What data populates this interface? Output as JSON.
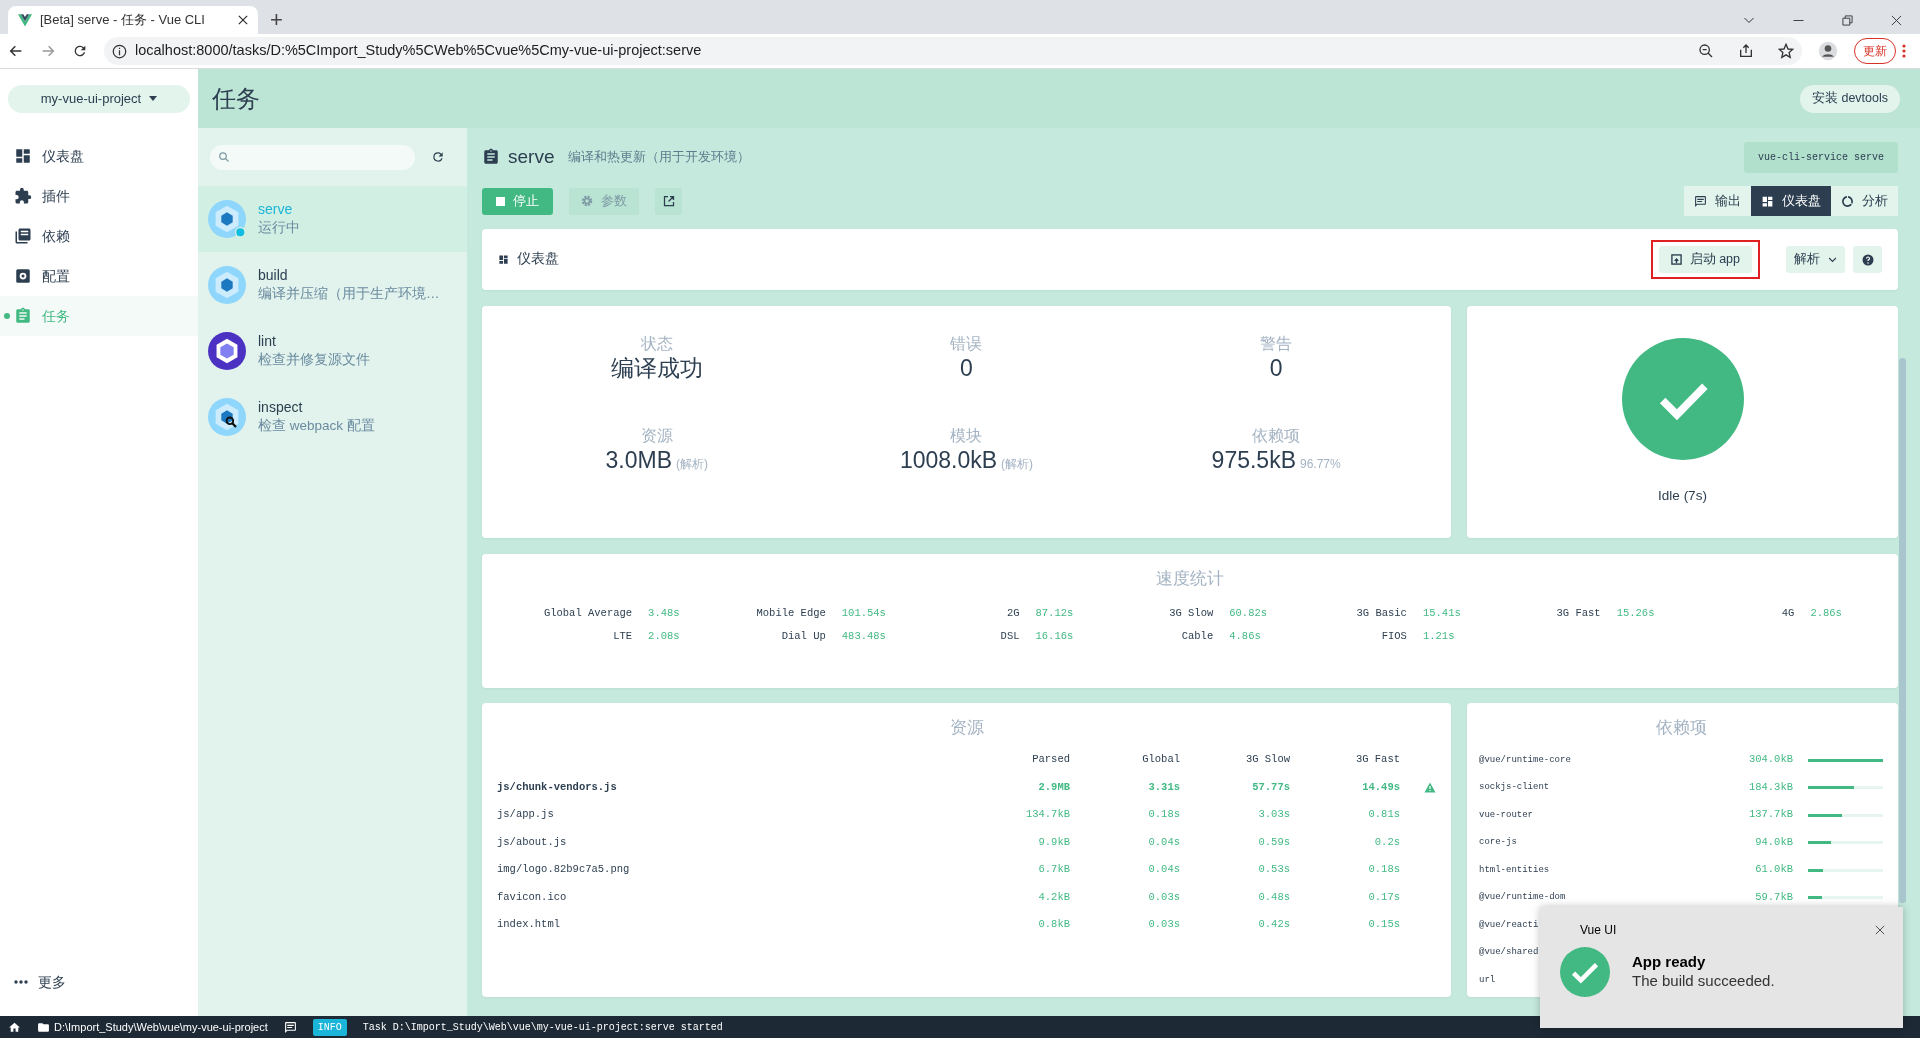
{
  "browser": {
    "tab_title": "[Beta] serve - 任务 - Vue CLI",
    "new_tab": "+",
    "url": "localhost:8000/tasks/D:%5CImport_Study%5CWeb%5Cvue%5Cmy-vue-ui-project:serve",
    "update_button": "更新"
  },
  "project_selector": "my-vue-ui-project",
  "page_title": "任务",
  "devtools_button": "安装 devtools",
  "sidebar": {
    "items": [
      {
        "label": "仪表盘",
        "kind": "dashboard",
        "selected": false
      },
      {
        "label": "插件",
        "kind": "plugins",
        "selected": false
      },
      {
        "label": "依赖",
        "kind": "dependencies",
        "selected": false
      },
      {
        "label": "配置",
        "kind": "configuration",
        "selected": false
      },
      {
        "label": "任务",
        "kind": "tasks",
        "selected": true
      }
    ],
    "more": "更多"
  },
  "tasks": [
    {
      "name": "serve",
      "description": "运行中",
      "kind": "webpack",
      "running": true,
      "selected": true
    },
    {
      "name": "build",
      "description": "编译并压缩（用于生产环境…",
      "kind": "webpack",
      "running": false,
      "selected": false
    },
    {
      "name": "lint",
      "description": "检查并修复源文件",
      "kind": "eslint",
      "running": false,
      "selected": false
    },
    {
      "name": "inspect",
      "description": "检查 webpack 配置",
      "kind": "inspect",
      "running": false,
      "selected": false
    }
  ],
  "task": {
    "name": "serve",
    "description": "编译和热更新（用于开发环境）",
    "command": "vue-cli-service serve",
    "stop_button": "停止",
    "params_button": "参数",
    "params_disabled": true,
    "views": [
      {
        "label": "输出",
        "kind": "output",
        "selected": false
      },
      {
        "label": "仪表盘",
        "kind": "dashboard",
        "selected": true
      },
      {
        "label": "分析",
        "kind": "analysis",
        "selected": false
      }
    ]
  },
  "dashboard": {
    "title": "仪表盘",
    "launch_button": "启动 app",
    "launch_highlighted": true,
    "analyzer_dropdown": "解析"
  },
  "stats": [
    {
      "label": "状态",
      "value": "编译成功"
    },
    {
      "label": "错误",
      "value": "0"
    },
    {
      "label": "警告",
      "value": "0"
    },
    {
      "label": "资源",
      "value": "3.0MB",
      "note": "(解析)"
    },
    {
      "label": "模块",
      "value": "1008.0kB",
      "note": "(解析)"
    },
    {
      "label": "依赖项",
      "value": "975.5kB",
      "note": "96.77%"
    }
  ],
  "status_card": {
    "caption": "Idle (7s)",
    "ok": true
  },
  "speed": {
    "title": "速度统计",
    "rows": [
      [
        {
          "label": "Global Average",
          "value": "3.48s"
        },
        {
          "label": "Mobile Edge",
          "value": "101.54s"
        },
        {
          "label": "2G",
          "value": "87.12s"
        },
        {
          "label": "3G Slow",
          "value": "60.82s"
        },
        {
          "label": "3G Basic",
          "value": "15.41s"
        },
        {
          "label": "3G Fast",
          "value": "15.26s"
        },
        {
          "label": "4G",
          "value": "2.86s"
        }
      ],
      [
        {
          "label": "LTE",
          "value": "2.08s"
        },
        {
          "label": "Dial Up",
          "value": "483.48s"
        },
        {
          "label": "DSL",
          "value": "16.16s"
        },
        {
          "label": "Cable",
          "value": "4.86s"
        },
        {
          "label": "FIOS",
          "value": "1.21s"
        }
      ]
    ]
  },
  "assets": {
    "title": "资源",
    "columns": [
      "Parsed",
      "Global",
      "3G Slow",
      "3G Fast"
    ],
    "rows": [
      {
        "name": "js/chunk-vendors.js",
        "values": [
          "2.9MB",
          "3.31s",
          "57.77s",
          "14.49s"
        ],
        "big": true
      },
      {
        "name": "js/app.js",
        "values": [
          "134.7kB",
          "0.18s",
          "3.03s",
          "0.81s"
        ],
        "big": false
      },
      {
        "name": "js/about.js",
        "values": [
          "9.9kB",
          "0.04s",
          "0.59s",
          "0.2s"
        ],
        "big": false
      },
      {
        "name": "img/logo.82b9c7a5.png",
        "values": [
          "6.7kB",
          "0.04s",
          "0.53s",
          "0.18s"
        ],
        "big": false
      },
      {
        "name": "favicon.ico",
        "values": [
          "4.2kB",
          "0.03s",
          "0.48s",
          "0.17s"
        ],
        "big": false
      },
      {
        "name": "index.html",
        "values": [
          "0.8kB",
          "0.03s",
          "0.42s",
          "0.15s"
        ],
        "big": false
      }
    ]
  },
  "dependencies": {
    "title": "依赖项",
    "rows": [
      {
        "name": "@vue/runtime-core",
        "size": "304.0kB",
        "level": 1.0
      },
      {
        "name": "sockjs-client",
        "size": "184.3kB",
        "level": 0.61
      },
      {
        "name": "vue-router",
        "size": "137.7kB",
        "level": 0.45
      },
      {
        "name": "core-js",
        "size": "94.0kB",
        "level": 0.31
      },
      {
        "name": "html-entities",
        "size": "61.0kB",
        "level": 0.2
      },
      {
        "name": "@vue/runtime-dom",
        "size": "59.7kB",
        "level": 0.19
      },
      {
        "name": "@vue/reacti"
      },
      {
        "name": "@vue/shared"
      },
      {
        "name": "url"
      }
    ]
  },
  "status_bar": {
    "folder": "D:\\Import_Study\\Web\\vue\\my-vue-ui-project",
    "log_level": "INFO",
    "message": "Task D:\\Import_Study\\Web\\vue\\my-vue-ui-project:serve started"
  },
  "notification": {
    "app": "Vue UI",
    "title": "App ready",
    "message": "The build succeeded."
  }
}
